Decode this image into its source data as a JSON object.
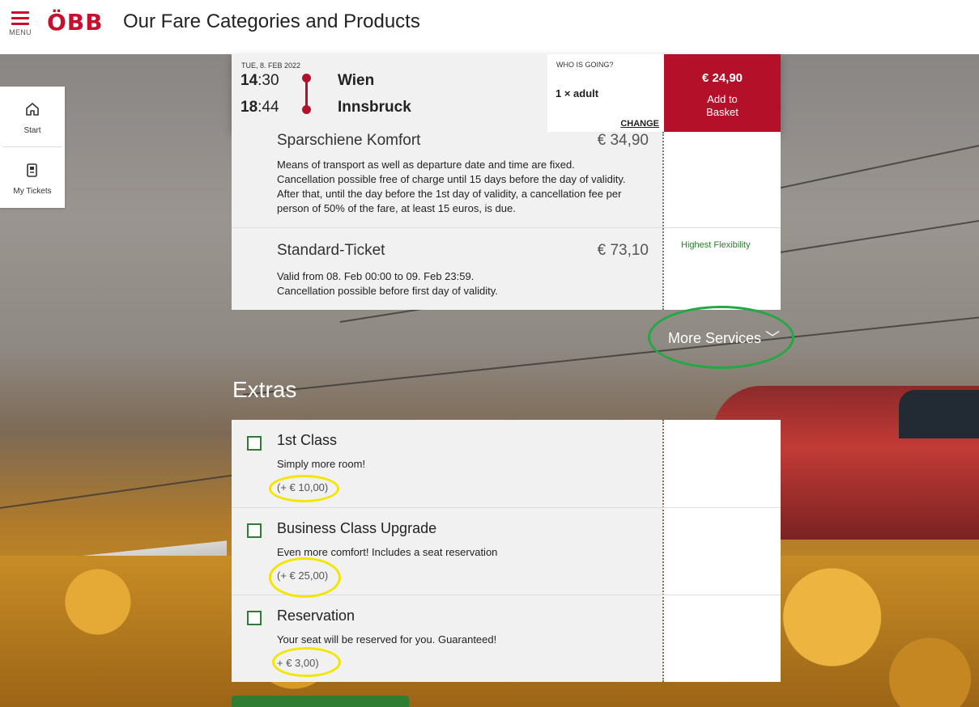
{
  "header": {
    "menu_label": "MENU",
    "logo_text": "ÖBB",
    "title": "Our Fare Categories and Products"
  },
  "sidenav": {
    "items": [
      {
        "label": "Start",
        "icon": "home-icon"
      },
      {
        "label": "My Tickets",
        "icon": "ticket-icon"
      }
    ]
  },
  "connection": {
    "date": "TUE, 8. FEB 2022",
    "departure": {
      "hour": "14",
      "minute": ":30",
      "station": "Wien"
    },
    "arrival": {
      "hour": "18",
      "minute": ":44",
      "station": "Innsbruck"
    },
    "who_label": "WHO IS GOING?",
    "who_value": "1 × adult",
    "change_label": "CHANGE",
    "price": "€ 24,90",
    "add_label": "Add to Basket"
  },
  "fares": [
    {
      "name": "Sparschiene Komfort",
      "price": "€ 34,90",
      "description": "Means of transport as well as departure date and time are fixed. Cancellation possible free of charge until 15 days before the day of validity. After that, until the day before the 1st day of validity, a cancellation fee per person of 50% of the fare, at least 15 euros, is due."
    },
    {
      "name": "Standard-Ticket",
      "price": "€ 73,10",
      "description_line1": "Valid from 08. Feb 00:00 to 09. Feb 23:59.",
      "description_line2": "Cancellation possible before first day of validity.",
      "badge": "Highest Flexibility"
    }
  ],
  "more_services_label": "More Services ﹀",
  "extras": {
    "title": "Extras",
    "items": [
      {
        "name": "1st Class",
        "description": "Simply more room!",
        "price": "(+ € 10,00)",
        "checked": false
      },
      {
        "name": "Business Class Upgrade",
        "description": "Even more comfort! Includes a seat reservation",
        "price": "(+ € 25,00)",
        "checked": false
      },
      {
        "name": "Reservation",
        "description": "Your seat will be reserved for you. Guaranteed!",
        "price": "+ € 3,00)",
        "checked": false
      }
    ]
  },
  "colors": {
    "brand_red": "#c8102e",
    "accent_green": "#2e7d32",
    "annotation_green": "#22a845",
    "annotation_yellow": "#f2e600"
  }
}
